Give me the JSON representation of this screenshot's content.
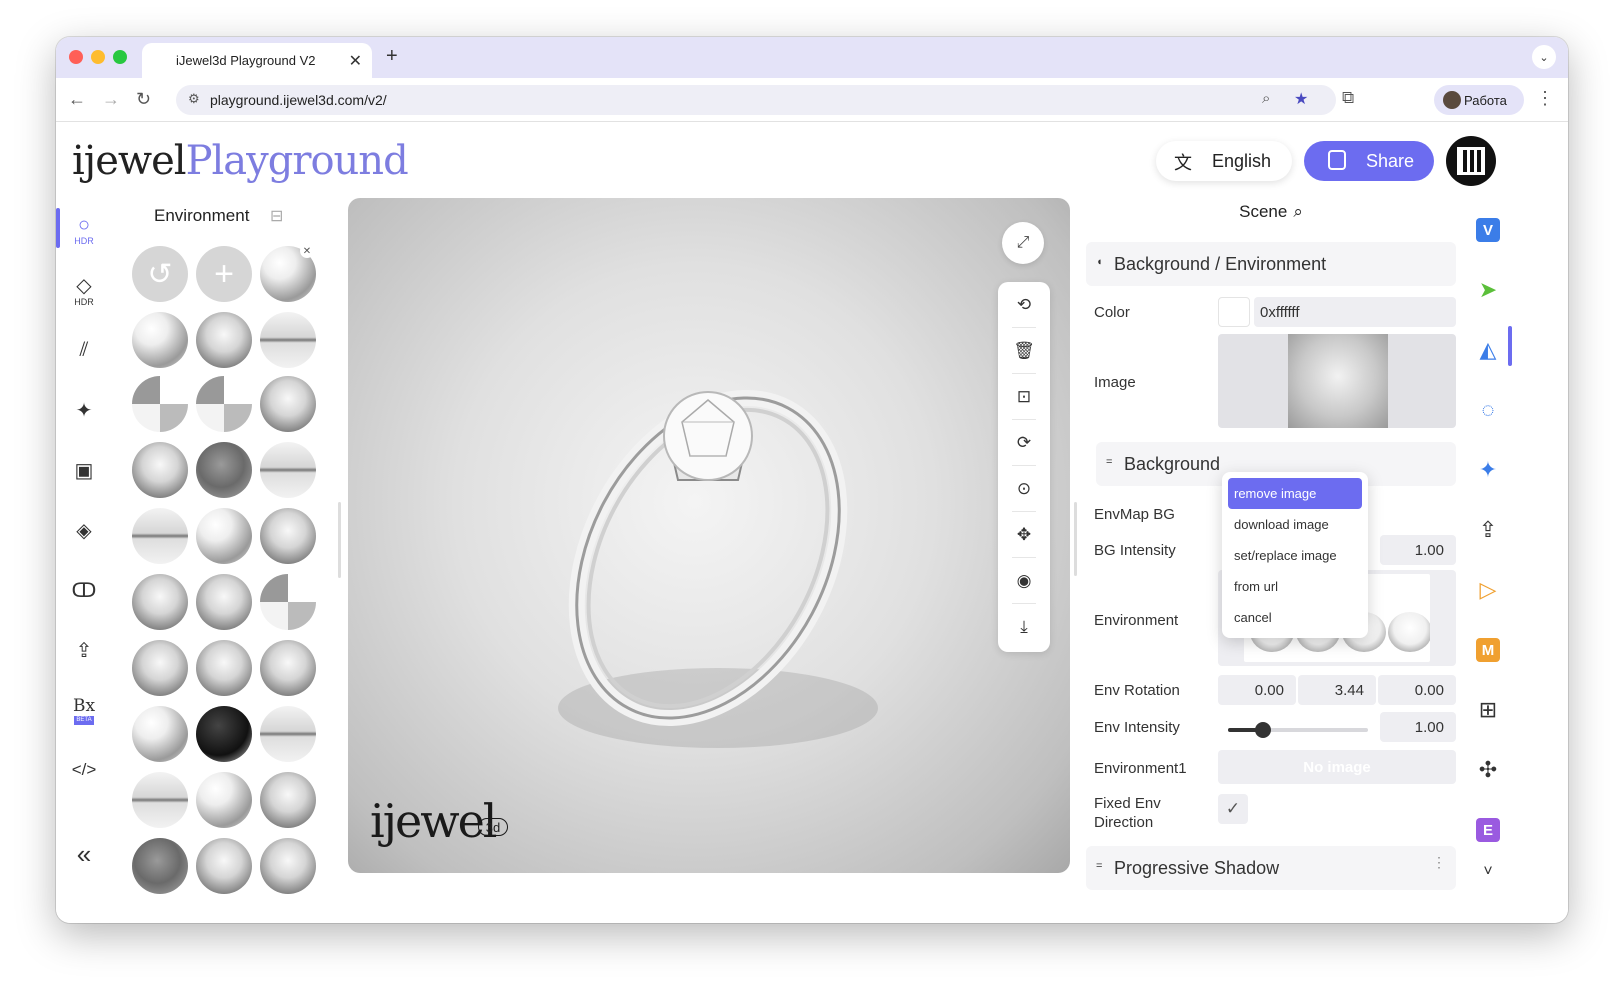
{
  "browser": {
    "tab_title": "iJewel3d Playground V2",
    "new_tab": "+",
    "url": "playground.ijewel3d.com/v2/",
    "profile_name": "Работа"
  },
  "header": {
    "logo_part1": "ijewel",
    "logo_part2": "Playground",
    "language_label": "English",
    "share_label": "Share"
  },
  "left_sidebar": {
    "items": [
      {
        "icon": "hdr-circle-icon",
        "sub": "HDR"
      },
      {
        "icon": "diamond-hdr-icon",
        "sub": "HDR"
      },
      {
        "icon": "stripes-icon",
        "sub": ""
      },
      {
        "icon": "sparkle-icon",
        "sub": ""
      },
      {
        "icon": "image-frame-icon",
        "sub": ""
      },
      {
        "icon": "gem-icon",
        "sub": ""
      },
      {
        "icon": "ring-icon",
        "sub": ""
      },
      {
        "icon": "upload-icon",
        "sub": ""
      },
      {
        "icon": "bx-logo-icon",
        "sub": "BETA"
      },
      {
        "icon": "code-icon",
        "sub": ""
      },
      {
        "icon": "collapse-icon",
        "sub": ""
      }
    ]
  },
  "environment_panel": {
    "title": "Environment"
  },
  "viewport": {
    "watermark": "ijewel",
    "watermark_badge": "3d"
  },
  "scene_panel": {
    "title": "Scene",
    "section1": "Background / Environment",
    "color_label": "Color",
    "color_value": "0xffffff",
    "image_label": "Image",
    "section2": "Background",
    "envmap_bg_label": "EnvMap BG",
    "bg_intensity_label": "BG Intensity",
    "bg_intensity_value": "1.00",
    "environment_label": "Environment",
    "env_rotation_label": "Env Rotation",
    "env_rotation_values": [
      "0.00",
      "3.44",
      "0.00"
    ],
    "env_intensity_label": "Env Intensity",
    "env_intensity_value": "1.00",
    "env_intensity_fraction": 0.25,
    "environment1_label": "Environment1",
    "environment1_value": "No image",
    "fixed_env_label_1": "Fixed Env",
    "fixed_env_label_2": "Direction",
    "fixed_env_checked": true,
    "section3": "Progressive Shadow"
  },
  "context_menu": {
    "items": [
      "remove image",
      "download image",
      "set/replace image",
      "from url",
      "cancel"
    ],
    "highlighted": "remove image"
  },
  "right_sidebar": {
    "items": [
      {
        "icon": "v-badge-icon",
        "label": "V",
        "color": "#3b7de8"
      },
      {
        "icon": "cursor-icon",
        "label": "",
        "color": "#5bbf3a"
      },
      {
        "icon": "shapes-icon",
        "label": "",
        "color": "#3b7de8"
      },
      {
        "icon": "circle-dash-icon",
        "label": "",
        "color": "#3b7de8"
      },
      {
        "icon": "star4-icon",
        "label": "",
        "color": "#3b7de8"
      },
      {
        "icon": "upload-box-icon",
        "label": "",
        "color": "#333333"
      },
      {
        "icon": "play-icon",
        "label": "",
        "color": "#f0a030"
      },
      {
        "icon": "m-badge-icon",
        "label": "M",
        "color": "#f0a030"
      },
      {
        "icon": "grid-icon",
        "label": "",
        "color": "#333333"
      },
      {
        "icon": "puzzle-icon",
        "label": "",
        "color": "#333333"
      },
      {
        "icon": "e-badge-icon",
        "label": "E",
        "color": "#9a5ae0"
      }
    ]
  }
}
